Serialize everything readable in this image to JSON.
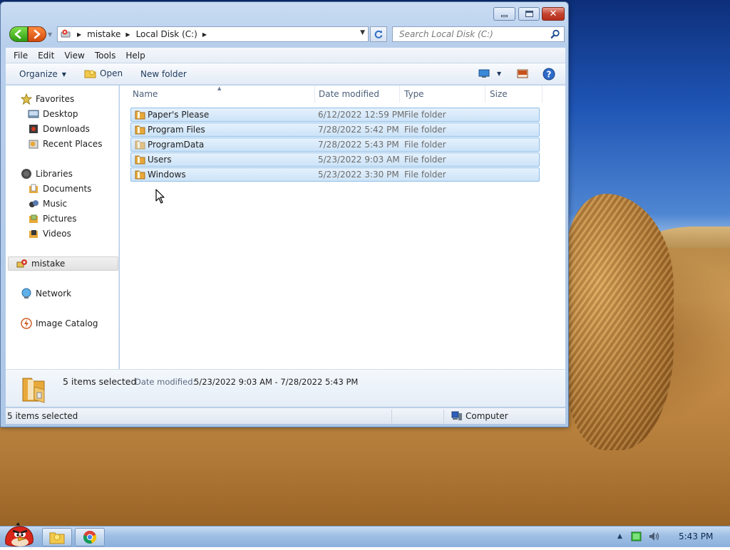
{
  "address": {
    "crumbs": [
      "mistake",
      "Local Disk (C:)"
    ],
    "search_placeholder": "Search Local Disk (C:)"
  },
  "menu": [
    "File",
    "Edit",
    "View",
    "Tools",
    "Help"
  ],
  "toolbar": {
    "organize": "Organize",
    "open": "Open",
    "new_folder": "New folder"
  },
  "nav": {
    "favorites": "Favorites",
    "desktop": "Desktop",
    "downloads": "Downloads",
    "recent_places": "Recent Places",
    "libraries": "Libraries",
    "documents": "Documents",
    "music": "Music",
    "pictures": "Pictures",
    "videos": "Videos",
    "mistake": "mistake",
    "network": "Network",
    "image_catalog": "Image Catalog"
  },
  "columns": [
    "Name",
    "Date modified",
    "Type",
    "Size"
  ],
  "files": [
    {
      "name": "Paper's Please",
      "date": "6/12/2022 12:59 PM",
      "type": "File folder"
    },
    {
      "name": "Program Files",
      "date": "7/28/2022 5:42 PM",
      "type": "File folder"
    },
    {
      "name": "ProgramData",
      "date": "7/28/2022 5:43 PM",
      "type": "File folder"
    },
    {
      "name": "Users",
      "date": "5/23/2022 9:03 AM",
      "type": "File folder"
    },
    {
      "name": "Windows",
      "date": "5/23/2022 3:30 PM",
      "type": "File folder"
    }
  ],
  "details": {
    "count": "5 items selected",
    "date_label": "Date modified:",
    "date_value": "5/23/2022 9:03 AM - 7/28/2022 5:43 PM"
  },
  "status": {
    "left": "5 items selected",
    "right": "Computer"
  },
  "taskbar": {
    "clock": "5:43 PM"
  },
  "colors": {
    "selection_fill": "#cce3f8",
    "selection_border": "#8fbfe8",
    "folder": "#e8a93a"
  }
}
